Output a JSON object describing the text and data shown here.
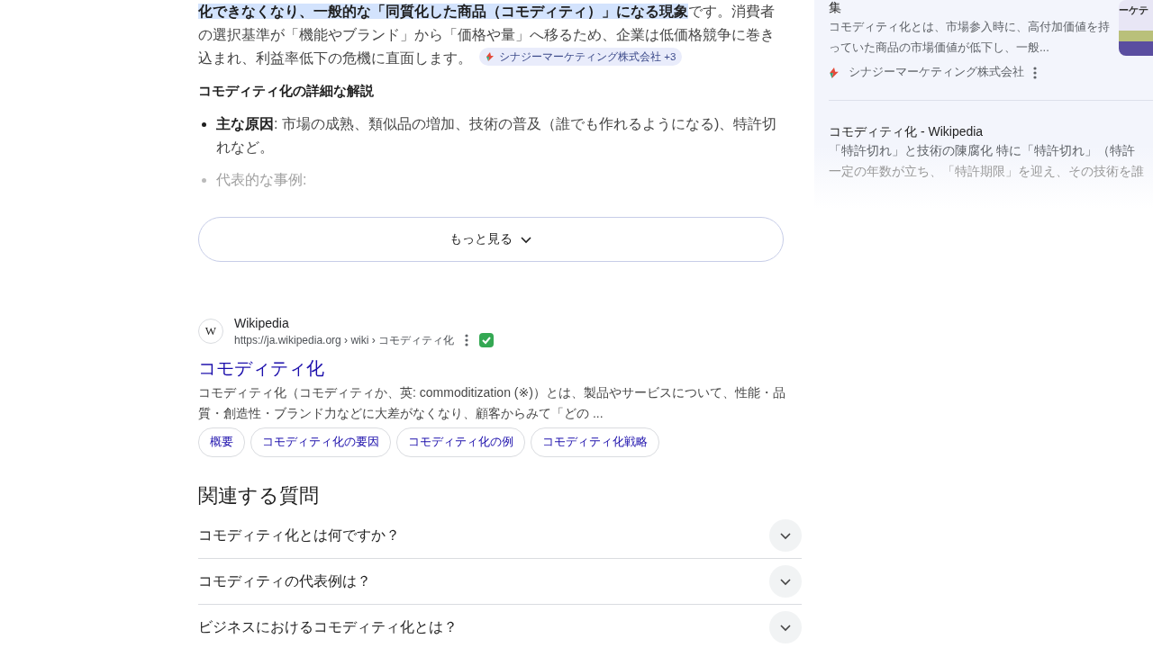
{
  "overview": {
    "paragraph": "**化できなくなり、一般的な「同質化した商品（コモディティ）」になる現象**です。消費者の選択基準が「機能やブランド」から「価格や量」へ移るため、企業は低価格競争に巻き込まれ、利益率低下の危機に直面します。",
    "source_chip": "シナジーマーケティング株式会社 +3",
    "heading": "コモディティ化の詳細な解説",
    "bullets": [
      {
        "text": "**主な原因**: 市場の成熟、類似品の増加、技術の普及（誰でも作れるようになる)、特許切れなど。",
        "faded": false
      },
      {
        "text": "代表的な事例:",
        "faded": true
      }
    ],
    "more_button": "もっと見る"
  },
  "side_panel": {
    "items": [
      {
        "title": "集",
        "snippet": "コモディティ化とは、市場参入時に、高付加価値を持っていた商品の市場価値が低下し、一般...",
        "source": "シナジーマーケティング株式会社",
        "thumbnail_text": "ーケテ"
      },
      {
        "title": "コモディティ化 - Wikipedia",
        "snippet": "「特許切れ」と技術の陳腐化 特に「特許切れ」（特許",
        "snippet_faded": "一定の年数が立ち、「特許期限」を迎え、その技術を誰"
      }
    ]
  },
  "result": {
    "favicon_letter": "W",
    "site": "Wikipedia",
    "url": "https://ja.wikipedia.org › wiki › コモディティ化",
    "verified": true,
    "title": "コモディティ化",
    "snippet": "コモディティ化（コモディティか、英: commoditization (※)）とは、製品やサービスについて、性能・品質・創造性・ブランド力などに大差がなくなり、顧客からみて「どの ...",
    "sitelinks": [
      "概要",
      "コモディティ化の要因",
      "コモディティ化の例",
      "コモディティ化戦略"
    ]
  },
  "related_questions": {
    "heading": "関連する質問",
    "items": [
      {
        "question": "コモディティ化とは何ですか？",
        "expanded": false
      },
      {
        "question": "コモディティの代表例は？",
        "expanded": false
      },
      {
        "question": "ビジネスにおけるコモディティ化とは？",
        "expanded": false
      }
    ]
  }
}
